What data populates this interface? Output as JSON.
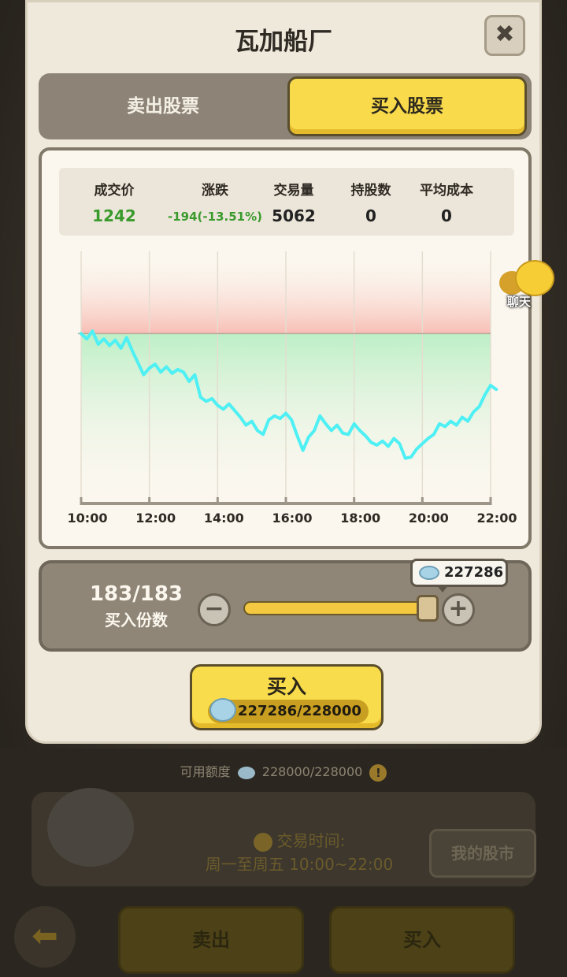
{
  "modal": {
    "title": "瓦加船厂",
    "close_label": "✖",
    "tabs": [
      {
        "label": "卖出股票",
        "active": false
      },
      {
        "label": "买入股票",
        "active": true
      }
    ]
  },
  "stats": {
    "price_label": "成交价",
    "price": "1242",
    "change_label": "涨跌",
    "change": "-194(-13.51%)",
    "volume_label": "交易量",
    "volume": "5062",
    "holdings_label": "持股数",
    "holdings": "0",
    "avg_cost_label": "平均成本",
    "avg_cost": "0"
  },
  "chart_data": {
    "type": "line",
    "x_ticks": [
      "10:00",
      "12:00",
      "14:00",
      "16:00",
      "18:00",
      "20:00",
      "22:00"
    ],
    "baseline": 1436,
    "color": "#4ef0f4",
    "series": [
      {
        "values": [
          [
            "10:00",
            1436
          ],
          [
            "10:10",
            1428
          ],
          [
            "10:20",
            1440
          ],
          [
            "10:30",
            1420
          ],
          [
            "10:40",
            1428
          ],
          [
            "10:50",
            1418
          ],
          [
            "11:00",
            1426
          ],
          [
            "11:10",
            1414
          ],
          [
            "11:20",
            1430
          ],
          [
            "11:30",
            1410
          ],
          [
            "11:40",
            1392
          ],
          [
            "11:50",
            1374
          ],
          [
            "12:00",
            1384
          ],
          [
            "12:10",
            1390
          ],
          [
            "12:20",
            1378
          ],
          [
            "12:30",
            1386
          ],
          [
            "12:40",
            1376
          ],
          [
            "12:50",
            1382
          ],
          [
            "13:00",
            1378
          ],
          [
            "13:10",
            1364
          ],
          [
            "13:20",
            1374
          ],
          [
            "13:30",
            1340
          ],
          [
            "13:40",
            1334
          ],
          [
            "13:50",
            1338
          ],
          [
            "14:00",
            1328
          ],
          [
            "14:10",
            1322
          ],
          [
            "14:20",
            1330
          ],
          [
            "14:30",
            1320
          ],
          [
            "14:40",
            1310
          ],
          [
            "14:50",
            1298
          ],
          [
            "15:00",
            1304
          ],
          [
            "15:10",
            1290
          ],
          [
            "15:20",
            1284
          ],
          [
            "15:30",
            1306
          ],
          [
            "15:40",
            1312
          ],
          [
            "15:50",
            1308
          ],
          [
            "16:00",
            1316
          ],
          [
            "16:10",
            1306
          ],
          [
            "16:20",
            1282
          ],
          [
            "16:30",
            1260
          ],
          [
            "16:40",
            1280
          ],
          [
            "16:50",
            1290
          ],
          [
            "17:00",
            1312
          ],
          [
            "17:10",
            1300
          ],
          [
            "17:20",
            1290
          ],
          [
            "17:30",
            1298
          ],
          [
            "17:40",
            1286
          ],
          [
            "17:50",
            1284
          ],
          [
            "18:00",
            1300
          ],
          [
            "18:10",
            1290
          ],
          [
            "18:20",
            1282
          ],
          [
            "18:30",
            1272
          ],
          [
            "18:40",
            1268
          ],
          [
            "18:50",
            1274
          ],
          [
            "19:00",
            1266
          ],
          [
            "19:10",
            1278
          ],
          [
            "19:20",
            1270
          ],
          [
            "19:30",
            1248
          ],
          [
            "19:40",
            1250
          ],
          [
            "19:50",
            1262
          ],
          [
            "20:00",
            1270
          ],
          [
            "20:10",
            1278
          ],
          [
            "20:20",
            1284
          ],
          [
            "20:30",
            1300
          ],
          [
            "20:40",
            1296
          ],
          [
            "20:50",
            1304
          ],
          [
            "21:00",
            1298
          ],
          [
            "21:10",
            1310
          ],
          [
            "21:20",
            1304
          ],
          [
            "21:30",
            1318
          ],
          [
            "21:40",
            1326
          ],
          [
            "21:50",
            1344
          ],
          [
            "22:00",
            1358
          ],
          [
            "22:10",
            1352
          ]
        ]
      }
    ],
    "ylim": [
      1180,
      1560
    ]
  },
  "slider": {
    "count": "183/183",
    "label": "买入份数",
    "minus": "−",
    "plus": "+",
    "fill_fraction": 1.0,
    "tooltip_value": "227286"
  },
  "buy_button": {
    "label": "买入",
    "price": "227286/228000"
  },
  "chat": {
    "label": "聊天"
  },
  "background": {
    "available": "可用额度",
    "available_value": "228000/228000",
    "warn": "!",
    "trade_time_label": "交易时间:",
    "trade_time_value": "周一至周五 10:00~22:00",
    "my_stock_label": "我的股市",
    "sell_label": "卖出",
    "buy_label": "买入",
    "back_icon": "⬅"
  }
}
